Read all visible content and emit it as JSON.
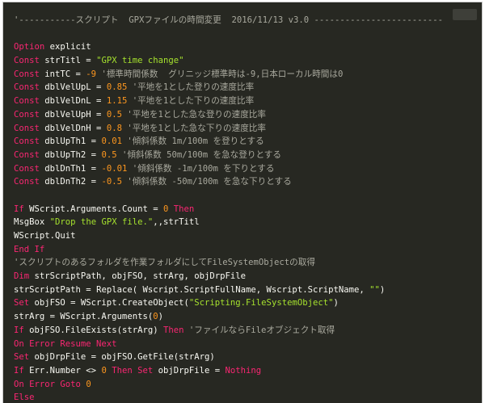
{
  "code": {
    "lines": [
      [
        [
          "cmt",
          "'-----------スクリプト  GPXファイルの時間変更  2016/11/13 v3.0 -------------------------"
        ]
      ],
      [],
      [
        [
          "kw",
          "Option"
        ],
        [
          "tx",
          " explicit"
        ]
      ],
      [
        [
          "kw",
          "Const"
        ],
        [
          "tx",
          " strTitl = "
        ],
        [
          "str",
          "\"GPX time change\""
        ]
      ],
      [
        [
          "kw",
          "Const"
        ],
        [
          "tx",
          " intTC = "
        ],
        [
          "num",
          "-9"
        ],
        [
          "cmt",
          " '標準時間係数  グリニッジ標準時は-9,日本ローカル時間は0"
        ]
      ],
      [
        [
          "kw",
          "Const"
        ],
        [
          "tx",
          " dblVelUpL = "
        ],
        [
          "num",
          "0.85"
        ],
        [
          "cmt",
          " '平地を1とした登りの速度比率"
        ]
      ],
      [
        [
          "kw",
          "Const"
        ],
        [
          "tx",
          " dblVelDnL = "
        ],
        [
          "num",
          "1.15"
        ],
        [
          "cmt",
          " '平地を1とした下りの速度比率"
        ]
      ],
      [
        [
          "kw",
          "Const"
        ],
        [
          "tx",
          " dblVelUpH = "
        ],
        [
          "num",
          "0.5"
        ],
        [
          "cmt",
          " '平地を1とした急な登りの速度比率"
        ]
      ],
      [
        [
          "kw",
          "Const"
        ],
        [
          "tx",
          " dblVelDnH = "
        ],
        [
          "num",
          "0.8"
        ],
        [
          "cmt",
          " '平地を1とした急な下りの速度比率"
        ]
      ],
      [
        [
          "kw",
          "Const"
        ],
        [
          "tx",
          " dblUpTh1 = "
        ],
        [
          "num",
          "0.01"
        ],
        [
          "cmt",
          " '傾斜係数 1m/100m を登りとする"
        ]
      ],
      [
        [
          "kw",
          "Const"
        ],
        [
          "tx",
          " dblUpTh2 = "
        ],
        [
          "num",
          "0.5"
        ],
        [
          "cmt",
          " '傾斜係数 50m/100m を急な登りとする"
        ]
      ],
      [
        [
          "kw",
          "Const"
        ],
        [
          "tx",
          " dblDnTh1 = "
        ],
        [
          "num",
          "-0.01"
        ],
        [
          "cmt",
          " '傾斜係数 -1m/100m を下りとする"
        ]
      ],
      [
        [
          "kw",
          "Const"
        ],
        [
          "tx",
          " dblDnTh2 = "
        ],
        [
          "num",
          "-0.5"
        ],
        [
          "cmt",
          " '傾斜係数 -50m/100m を急な下りとする"
        ]
      ],
      [],
      [
        [
          "kw",
          "If"
        ],
        [
          "tx",
          " WScript.Arguments.Count = "
        ],
        [
          "num",
          "0"
        ],
        [
          "kw",
          " Then"
        ]
      ],
      [
        [
          "fn",
          "MsgBox"
        ],
        [
          "tx",
          " "
        ],
        [
          "str",
          "\"Drop the GPX file.\""
        ],
        [
          "tx",
          ",,strTitl"
        ]
      ],
      [
        [
          "tx",
          "WScript.Quit"
        ]
      ],
      [
        [
          "kw",
          "End If"
        ]
      ],
      [
        [
          "cmt",
          "'スクリプトのあるフォルダを作業フォルダにしてFileSystemObjectの取得"
        ]
      ],
      [
        [
          "kw",
          "Dim"
        ],
        [
          "tx",
          " strScriptPath, objFSO, strArg, objDrpFile"
        ]
      ],
      [
        [
          "tx",
          "strScriptPath = "
        ],
        [
          "fn",
          "Replace"
        ],
        [
          "tx",
          "( Wscript.ScriptFullName, Wscript.ScriptName, "
        ],
        [
          "str",
          "\"\""
        ],
        [
          "tx",
          ")"
        ]
      ],
      [
        [
          "kw",
          "Set"
        ],
        [
          "tx",
          " objFSO = WScript."
        ],
        [
          "fn",
          "CreateObject"
        ],
        [
          "tx",
          "("
        ],
        [
          "str",
          "\"Scripting.FileSystemObject\""
        ],
        [
          "tx",
          ")"
        ]
      ],
      [
        [
          "tx",
          "strArg = WScript.Arguments("
        ],
        [
          "num",
          "0"
        ],
        [
          "tx",
          ")"
        ]
      ],
      [
        [
          "kw",
          "If"
        ],
        [
          "tx",
          " objFSO.FileExists(strArg) "
        ],
        [
          "kw",
          "Then"
        ],
        [
          "cmt",
          " 'ファイルならFileオブジェクト取得"
        ]
      ],
      [
        [
          "kw",
          "On Error Resume Next"
        ]
      ],
      [
        [
          "kw",
          "Set"
        ],
        [
          "tx",
          " objDrpFile = objFSO.GetFile(strArg)"
        ]
      ],
      [
        [
          "kw",
          "If"
        ],
        [
          "tx",
          " Err.Number <> "
        ],
        [
          "num",
          "0"
        ],
        [
          "kw",
          " Then Set"
        ],
        [
          "tx",
          " objDrpFile = "
        ],
        [
          "kw",
          "Nothing"
        ]
      ],
      [
        [
          "kw",
          "On Error Goto"
        ],
        [
          "tx",
          " "
        ],
        [
          "num",
          "0"
        ]
      ],
      [
        [
          "kw",
          "Else"
        ]
      ]
    ]
  }
}
